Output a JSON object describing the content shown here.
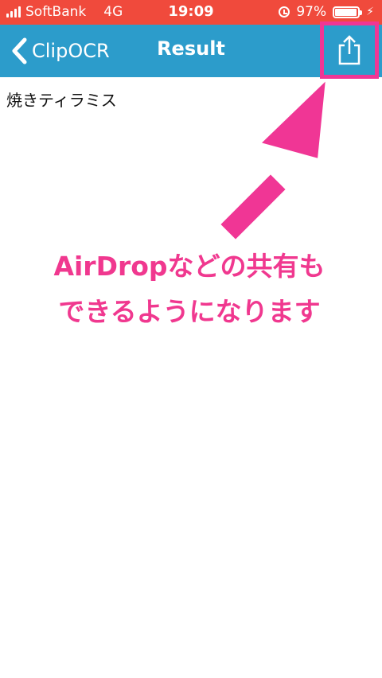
{
  "status_bar": {
    "carrier": "SoftBank",
    "network": "4G",
    "time": "19:09",
    "battery_percent": "97%",
    "battery_level": 0.97,
    "icons": [
      "signal-icon",
      "alarm-icon",
      "battery-icon",
      "charging-bolt-icon"
    ]
  },
  "nav": {
    "back_label": "ClipOCR",
    "title": "Result",
    "share_icon": "share-icon"
  },
  "content": {
    "result_text": "焼きティラミス"
  },
  "annotation": {
    "line1": "AirDropなどの共有も",
    "line2": "できるようになります",
    "accent_color": "#f03695"
  },
  "colors": {
    "status_bar": "#f04a3c",
    "nav_bar": "#2c9ccb",
    "highlight": "#f03695"
  }
}
